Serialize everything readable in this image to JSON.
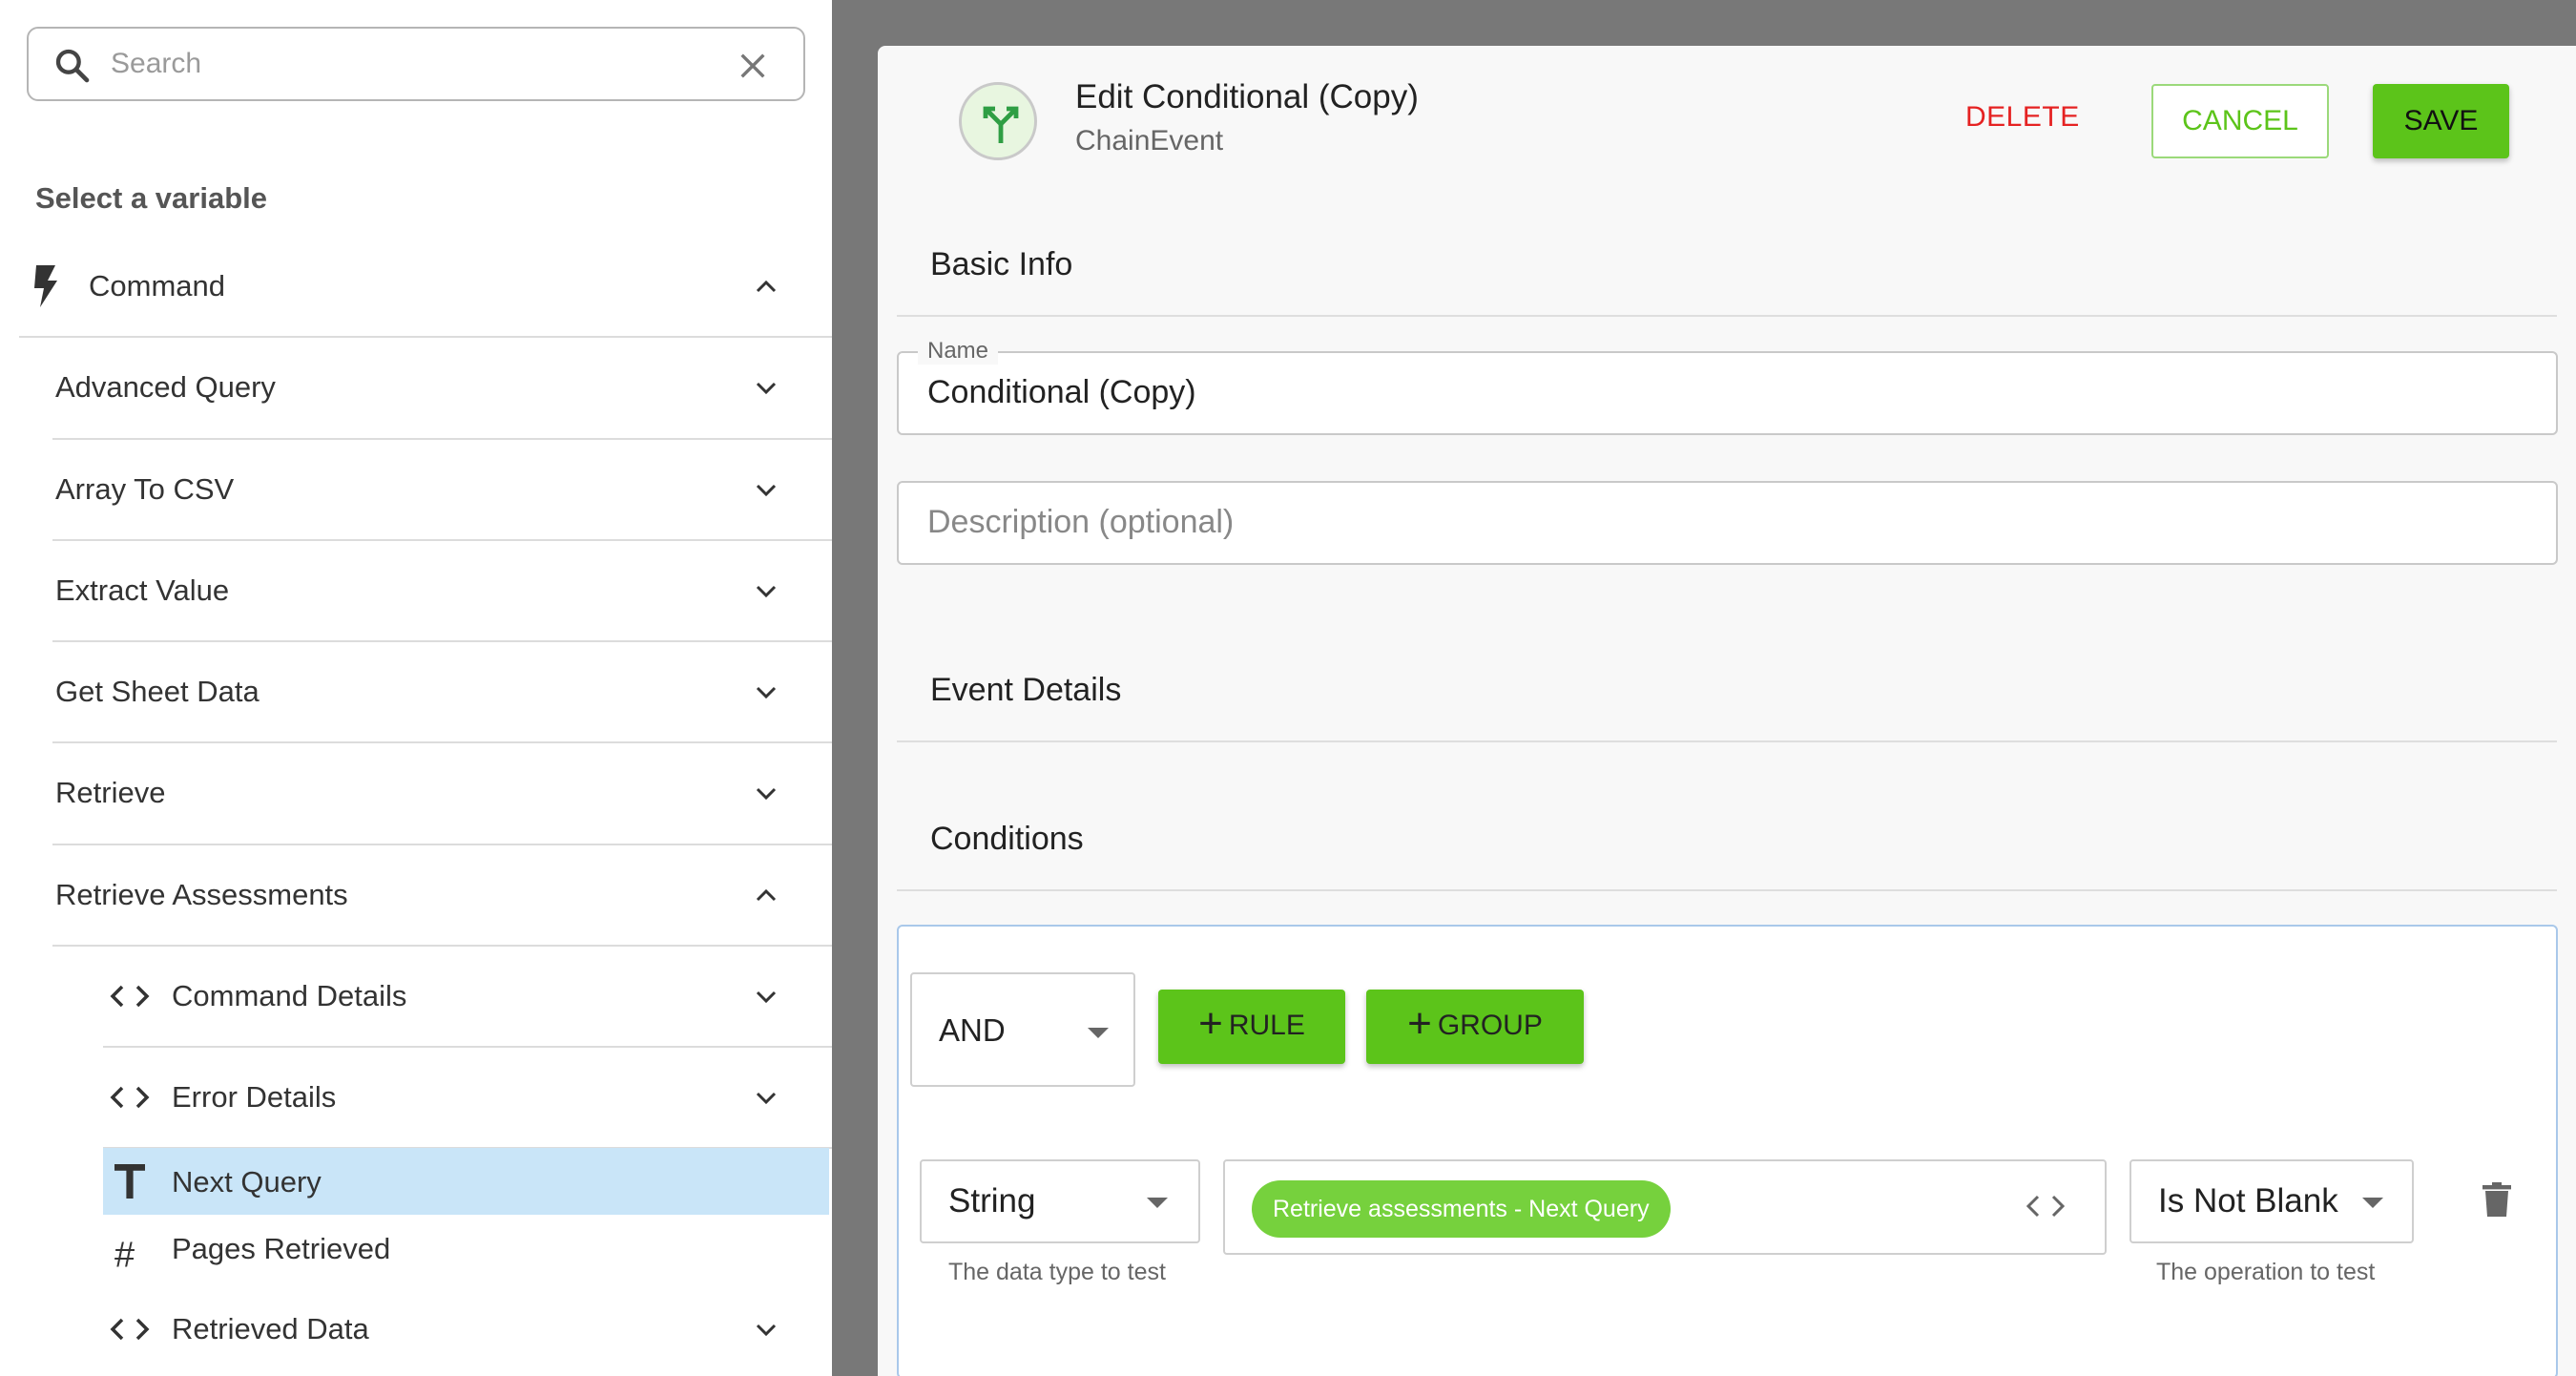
{
  "left_panel": {
    "search": {
      "placeholder": "Search",
      "icon": "search-icon",
      "clear_icon": "close-icon"
    },
    "title": "Select a variable",
    "items": [
      {
        "label": "Command",
        "icon": "lightning-icon",
        "expanded": true
      },
      {
        "label": "Advanced Query",
        "expanded": false
      },
      {
        "label": "Array To CSV",
        "expanded": false
      },
      {
        "label": "Extract Value",
        "expanded": false
      },
      {
        "label": "Get Sheet Data",
        "expanded": false
      },
      {
        "label": "Retrieve",
        "expanded": false
      },
      {
        "label": "Retrieve Assessments",
        "expanded": true
      },
      {
        "label": "Command Details",
        "icon": "code-icon",
        "expanded": false
      },
      {
        "label": "Error Details",
        "icon": "code-icon",
        "expanded": false
      },
      {
        "label": "Next Query",
        "icon": "text-type-icon",
        "selected": true
      },
      {
        "label": "Pages Retrieved",
        "icon": "hash-icon"
      },
      {
        "label": "Retrieved Data",
        "icon": "code-icon",
        "expanded": false
      }
    ]
  },
  "editor": {
    "title": "Edit Conditional (Copy)",
    "subtitle": "ChainEvent",
    "icon": "branch-icon",
    "delete_label": "DELETE",
    "cancel_label": "CANCEL",
    "save_label": "SAVE",
    "sections": {
      "basic_info": "Basic Info",
      "event_details": "Event Details",
      "conditions": "Conditions"
    },
    "name_field": {
      "label": "Name",
      "value": "Conditional (Copy)"
    },
    "description_field": {
      "placeholder": "Description (optional)"
    },
    "conditions": {
      "combinator": "AND",
      "add_rule_label": "RULE",
      "add_group_label": "GROUP",
      "rule": {
        "data_type": "String",
        "data_type_helper": "The data type to test",
        "variable_chip": "Retrieve assessments - Next Query",
        "operation": "Is Not Blank",
        "operation_helper": "The operation to test"
      }
    }
  },
  "colors": {
    "accent_green": "#5cc41a",
    "delete_red": "#e52222",
    "selected_row": "#c9e5f8",
    "chip_green": "#76d13d"
  }
}
